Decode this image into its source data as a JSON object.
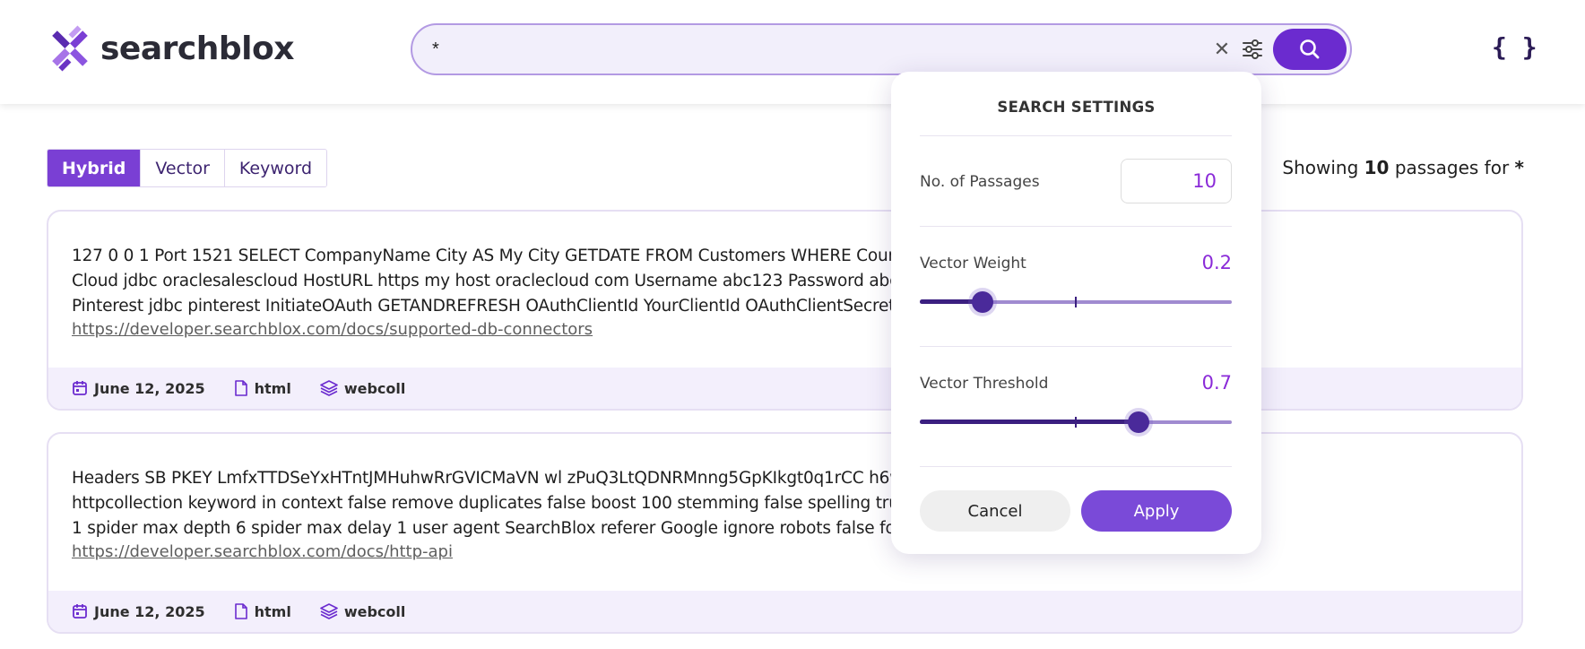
{
  "brand": {
    "name": "searchblox",
    "accent": "#6b2bcf"
  },
  "header": {
    "search_value": "*",
    "clear_icon": "close-icon",
    "filter_icon": "sliders-icon",
    "search_icon": "search-icon",
    "json_toggle": "{ }"
  },
  "tabs": [
    {
      "label": "Hybrid",
      "active": true
    },
    {
      "label": "Vector",
      "active": false
    },
    {
      "label": "Keyword",
      "active": false
    }
  ],
  "summary": {
    "prefix": "Showing",
    "count": "10",
    "middle": "passages for",
    "query": "*"
  },
  "results": [
    {
      "lines": [
        "127 0 0 1 Port 1521 SELECT CompanyName City AS My City GETDATE FROM Customers WHERE Country US htt datajdbc htm Oracle Sales",
        "Cloud jdbc oraclesalescloud HostURL https my host oraclecloud com Username abc123 Password abcdef SELE EOE jdbc pg select htm",
        "Pinterest jdbc pinterest InitiateOAuth GETANDREFRESH OAuthClientId YourClientId OAuthClientSecret YourClie ECT FROM"
      ],
      "url": "https://developer.searchblox.com/docs/supported-db-connectors",
      "date": "June 12, 2025",
      "type": "html",
      "collection": "webcoll"
    },
    {
      "lines": [
        "Headers SB PKEY LmfxTTDSeYxHTntJMHuhwRrGVICMaVN wl zPuQ3LtQDNRMnng5GpKIkgt0q1rCC h6wDA Do 09EFC87E8415CDAA colname",
        "httpcollection keyword in context false remove duplicates false boost 100 stemming false spelling true logging ta max doc age 1 max doc size",
        "1 spider max depth 6 spider max delay 1 user agent SearchBlox referer Google ignore robots false follow sitema"
      ],
      "url": "https://developer.searchblox.com/docs/http-api",
      "date": "June 12, 2025",
      "type": "html",
      "collection": "webcoll"
    }
  ],
  "settings": {
    "title": "SEARCH SETTINGS",
    "passages_label": "No. of Passages",
    "passages_value": "10",
    "vector_weight_label": "Vector Weight",
    "vector_weight_value": "0.2",
    "vector_weight": 0.2,
    "vector_threshold_label": "Vector Threshold",
    "vector_threshold_value": "0.7",
    "vector_threshold": 0.7,
    "cancel_label": "Cancel",
    "apply_label": "Apply"
  }
}
